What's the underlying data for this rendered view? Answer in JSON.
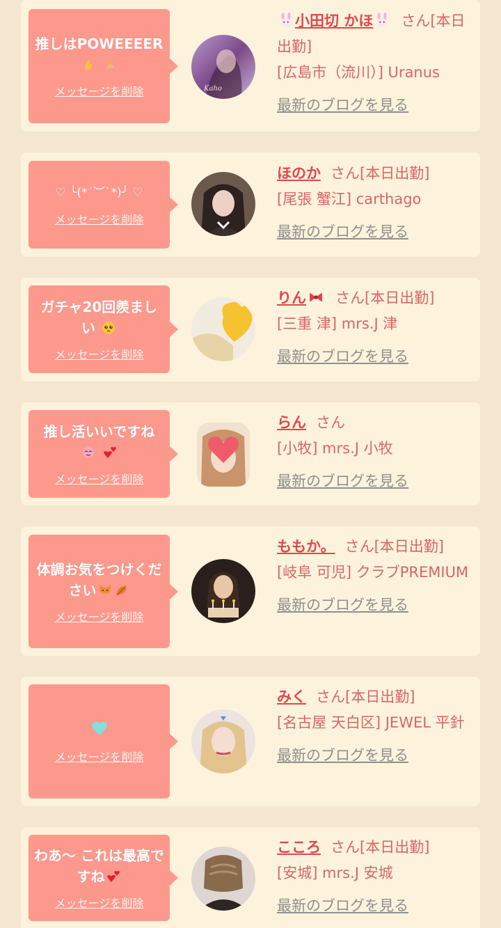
{
  "delete_label": "メッセージを削除",
  "blog_label": "最新のブログを見る",
  "san_label": "さん",
  "cards": [
    {
      "message": "推しはPOWEEEER",
      "name": "小田切 かほ",
      "status": "[本日出勤]",
      "shop": "[広島市（流川）] Uranus"
    },
    {
      "message": "♡ ╰(*´︶`*)╯ ♡",
      "name": "ほのか",
      "status": "[本日出勤]",
      "shop": "[尾張 蟹江] carthago"
    },
    {
      "message": "ガチャ20回羨ましい",
      "name": "りん",
      "status": "[本日出勤]",
      "shop": "[三重 津] mrs.J 津"
    },
    {
      "message": "推し活いいですね",
      "name": "らん",
      "status": "",
      "shop": "[小牧] mrs.J 小牧"
    },
    {
      "message": "体調お気をつけください",
      "name": "ももか。",
      "status": "[本日出勤]",
      "shop": "[岐阜 可児] クラブPREMIUM"
    },
    {
      "message": "",
      "name": "みく",
      "status": "[本日出勤]",
      "shop": "[名古屋 天白区] JEWEL 平針"
    },
    {
      "message": "わあ〜 これは最高ですね",
      "name": "こころ",
      "status": "[本日出勤]",
      "shop": "[安城] mrs.J 安城"
    }
  ]
}
